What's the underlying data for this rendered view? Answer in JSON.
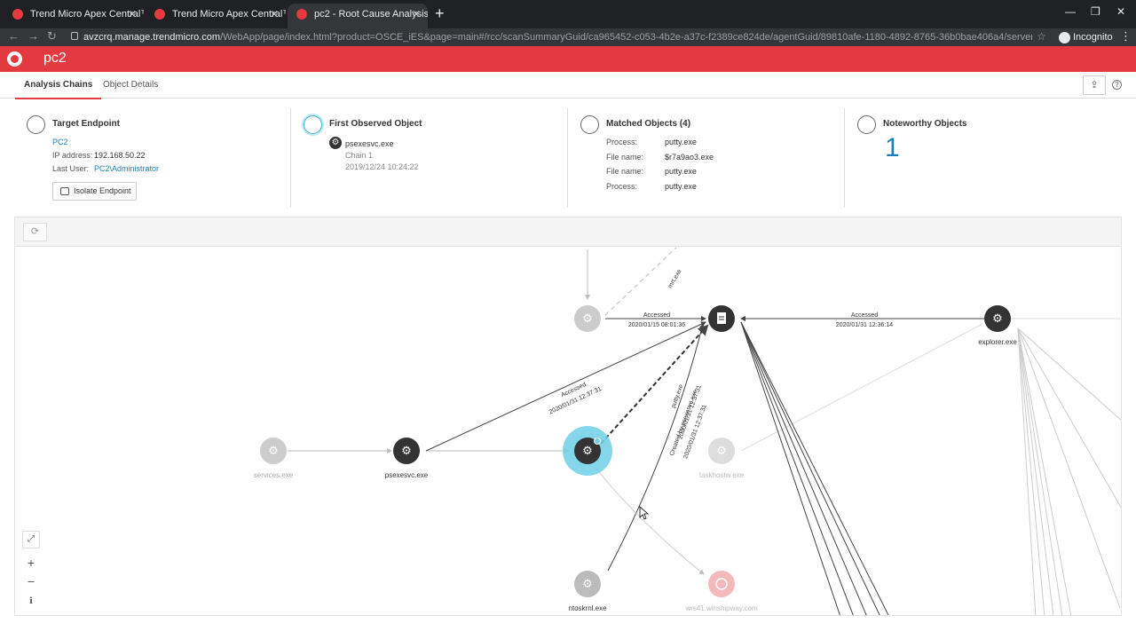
{
  "browser": {
    "tabs": [
      {
        "title": "Trend Micro Apex Central™",
        "active": false
      },
      {
        "title": "Trend Micro Apex Central™",
        "active": false
      },
      {
        "title": "pc2 - Root Cause Analysis",
        "active": true
      }
    ],
    "url_host": "avzcrq.manage.trendmicro.com",
    "url_path": "/WebApp/page/index.html?product=OSCE_iES&page=main#/rcc/scanSummaryGuid/ca965452-c053-4b2e-a37c-f2389ce824de/agentGuid/89810afe-1180-4892-8765-36b0bae406a4/serverGuid/A0FBECD7-A822-4C9D-B5A8-4...",
    "incognito_label": "Incognito"
  },
  "header": {
    "title": "pc2"
  },
  "subtabs": [
    {
      "label": "Analysis Chains",
      "active": true
    },
    {
      "label": "Object Details",
      "active": false
    }
  ],
  "target_endpoint": {
    "title": "Target Endpoint",
    "name": "PC2",
    "ip_label": "IP address:",
    "ip_value": "192.168.50.22",
    "user_label": "Last User:",
    "user_value": "PC2\\Administrator",
    "isolate_label": "Isolate Endpoint"
  },
  "first_observed": {
    "title": "First Observed Object",
    "object": "psexesvc.exe",
    "chain": "Chain 1",
    "timestamp": "2019/12/24 10:24:22"
  },
  "matched_objects": {
    "title": "Matched Objects (4)",
    "rows": [
      {
        "label": "Process:",
        "value": "putty.exe"
      },
      {
        "label": "File name:",
        "value": "$r7a9ao3.exe"
      },
      {
        "label": "File name:",
        "value": "putty.exe"
      },
      {
        "label": "Process:",
        "value": "putty.exe"
      }
    ]
  },
  "noteworthy": {
    "title": "Noteworthy Objects",
    "count": "1"
  },
  "graph": {
    "nodes": {
      "services": "services.exe",
      "psexesvc": "psexesvc.exe",
      "explorer": "explorer.exe",
      "taskhostw": "taskhostw.exe",
      "ntoskrnl": "ntoskrnl.exe",
      "wrs": "wrs41.winshipway.com",
      "mrt": "mrt.exe"
    },
    "edges": {
      "e1_action": "Accessed",
      "e1_time": "2020/01/15 08:01:36",
      "e2_action": "Accessed",
      "e2_time": "2020/01/31 12:36:14",
      "e3_action": "Accessed",
      "e3_time": "2020/01/31 12:37:31",
      "e4_name": "putty.exe",
      "e4_time": "2020/01/31 12:37:31",
      "e5_action": "Created by psexesvc.exe",
      "e5_time": "2020/01/31 12:37:31"
    }
  }
}
